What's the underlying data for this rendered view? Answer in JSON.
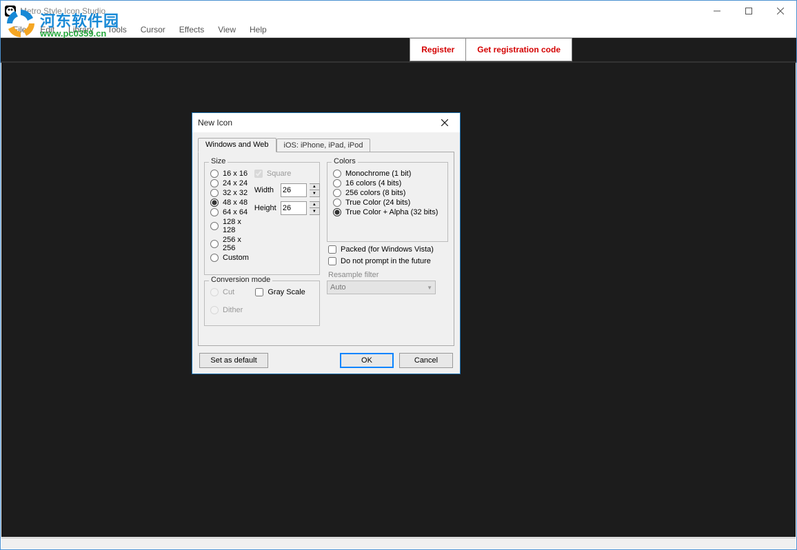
{
  "app": {
    "title": "Metro Style Icon Studio"
  },
  "menus": [
    "File",
    "Edit",
    "Library",
    "Tools",
    "Cursor",
    "Effects",
    "View",
    "Help"
  ],
  "watermark": {
    "cn": "河东软件园",
    "url": "www.pc0359.cn"
  },
  "toolbar": {
    "register": "Register",
    "getcode": "Get registration code"
  },
  "dialog": {
    "title": "New Icon",
    "tabs": [
      "Windows and Web",
      "iOS: iPhone, iPad, iPod"
    ],
    "size": {
      "legend": "Size",
      "options": [
        "16 x 16",
        "24 x 24",
        "32 x 32",
        "48 x 48",
        "64 x 64",
        "128 x 128",
        "256 x 256",
        "Custom"
      ],
      "selected": "48 x 48",
      "square_label": "Square",
      "square_checked": true,
      "width_label": "Width",
      "height_label": "Height",
      "width_value": "26",
      "height_value": "26"
    },
    "conversion": {
      "legend": "Conversion mode",
      "cut": "Cut",
      "dither": "Dither",
      "grayscale": "Gray Scale"
    },
    "colors": {
      "legend": "Colors",
      "options": [
        "Monochrome (1 bit)",
        "16 colors (4 bits)",
        "256 colors (8 bits)",
        "True Color (24 bits)",
        "True Color + Alpha (32 bits)"
      ],
      "selected": "True Color + Alpha (32 bits)"
    },
    "packed_label": "Packed (for Windows Vista)",
    "noprompt_label": "Do not prompt in the future",
    "resample_label": "Resample filter",
    "resample_value": "Auto",
    "buttons": {
      "default": "Set as default",
      "ok": "OK",
      "cancel": "Cancel"
    }
  }
}
